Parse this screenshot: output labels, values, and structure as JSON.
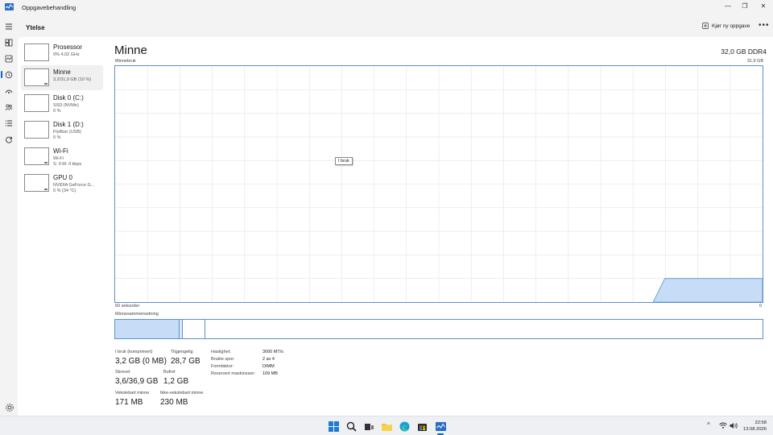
{
  "window": {
    "title": "Oppgavebehandling",
    "controls": {
      "minimize": "—",
      "restore": "❐",
      "close": "✕"
    }
  },
  "header": {
    "page_title": "Ytelse",
    "run_task_label": "Kjør ny oppgave",
    "more_label": "•••"
  },
  "nav": {
    "items": [
      "menu-icon",
      "processes-icon",
      "performance-icon",
      "history-icon",
      "startup-icon",
      "users-icon",
      "details-icon",
      "services-icon"
    ],
    "settings": "gear-icon"
  },
  "devices": [
    {
      "name": "Prosessor",
      "sub1": "0% 4,02 GHz",
      "sub2": ""
    },
    {
      "name": "Minne",
      "sub1": "3,2/31,9 GB (10 %)",
      "sub2": ""
    },
    {
      "name": "Disk 0 (C:)",
      "sub1": "SSD (NVMe)",
      "sub2": "0 %"
    },
    {
      "name": "Disk 1 (D:)",
      "sub1": "Flyttbar (USB)",
      "sub2": "0 %"
    },
    {
      "name": "Wi-Fi",
      "sub1": "Wi-Fi",
      "sub2": "S: 0 M: 0 kbps"
    },
    {
      "name": "GPU 0",
      "sub1": "NVIDIA GeForce G...",
      "sub2": "0 % (34 °C)"
    }
  ],
  "memory": {
    "title": "Minne",
    "spec": "32,0 GB DDR4",
    "graph_label": "Minnebruk",
    "graph_max": "31,9 GB",
    "time_label": "60 sekunder",
    "zero_label": "0",
    "tooltip": "I bruk",
    "composition_label": "Minnesammensetning",
    "graph_fill_fraction": 0.1,
    "composition": {
      "in_use_fraction": 0.1,
      "modified_fraction": 0.004,
      "standby_fraction": 0.035
    },
    "colors": {
      "fill": "#c7dcf7",
      "line": "#5b8fd0"
    },
    "stats": {
      "in_use_label": "I bruk (komprimert)",
      "in_use_value": "3,2 GB (0 MB)",
      "available_label": "Tilgjengelig",
      "available_value": "28,7 GB",
      "committed_label": "Skrevet",
      "committed_value": "3,6/36,9 GB",
      "cached_label": "Bufret",
      "cached_value": "1,2 GB",
      "paged_label": "Vekslebart minne",
      "paged_value": "171 MB",
      "nonpaged_label": "Ikke-vekslebart minne",
      "nonpaged_value": "230 MB"
    },
    "details": [
      {
        "key": "Hastighet:",
        "value": "3000 MT/s"
      },
      {
        "key": "Brukte spor:",
        "value": "2 av 4"
      },
      {
        "key": "Formfaktor:",
        "value": "DIMM"
      },
      {
        "key": "Reservert maskinvare:",
        "value": "109 MB"
      }
    ]
  },
  "taskbar": {
    "apps": [
      "windows-start-icon",
      "search-icon",
      "task-view-icon",
      "file-explorer-icon",
      "edge-icon",
      "store-icon",
      "task-manager-icon"
    ],
    "tray": {
      "chevron": "^"
    },
    "time": "22:58",
    "date": "13.08.2026"
  }
}
